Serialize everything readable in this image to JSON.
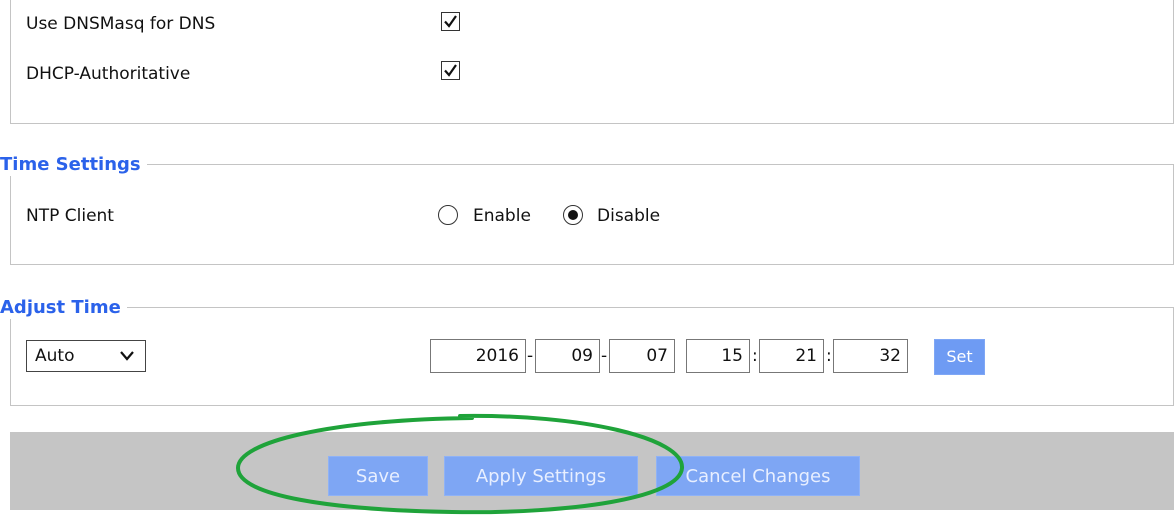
{
  "dhcp": {
    "dnsmasq_label": "Use DNSMasq for DNS",
    "dnsmasq_checked": true,
    "authoritative_label": "DHCP-Authoritative",
    "authoritative_checked": true
  },
  "time_settings": {
    "legend": "Time Settings",
    "ntp_label": "NTP Client",
    "options": [
      {
        "label": "Enable",
        "selected": false
      },
      {
        "label": "Disable",
        "selected": true
      }
    ]
  },
  "adjust_time": {
    "legend": "Adjust Time",
    "mode": "Auto",
    "year": "2016",
    "month": "09",
    "day": "07",
    "hour": "15",
    "minute": "21",
    "second": "32",
    "date_sep": "-",
    "time_sep": ":",
    "set_label": "Set"
  },
  "footer": {
    "save_label": "Save",
    "apply_label": "Apply Settings",
    "cancel_label": "Cancel Changes"
  },
  "colors": {
    "legend": "#2b62ea",
    "button": "#7ea6f4",
    "footer_bg": "#c5c5c5",
    "annotation": "#1fa33a"
  }
}
